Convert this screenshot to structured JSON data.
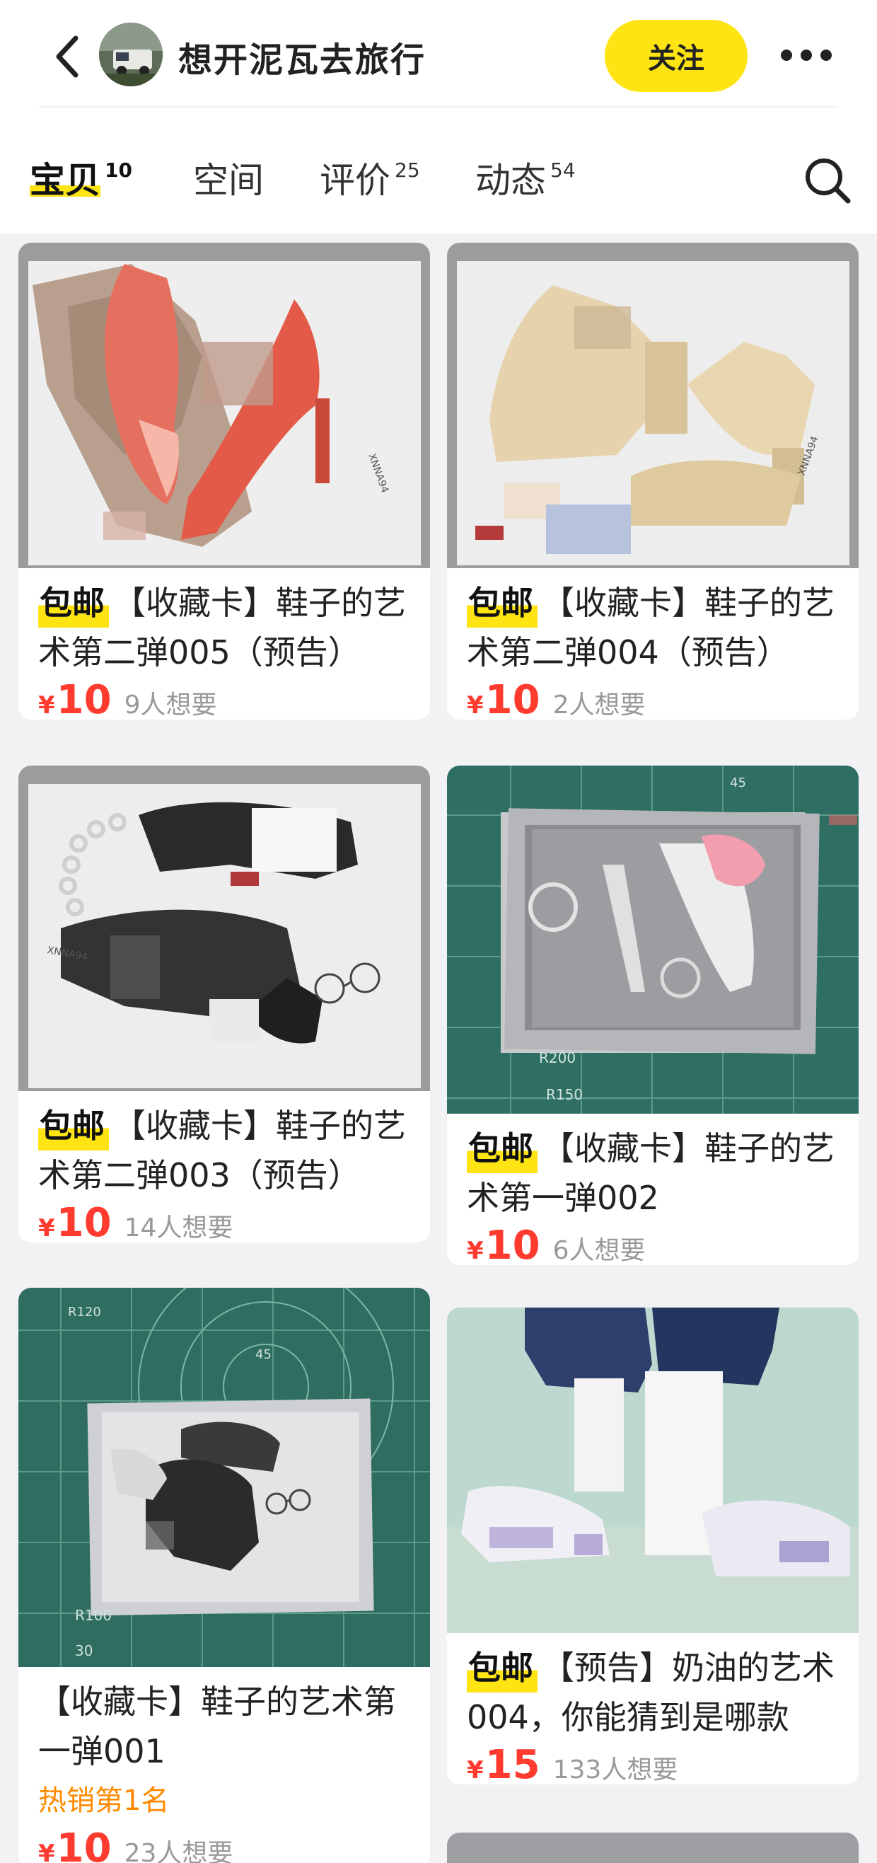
{
  "header": {
    "shop_name": "想开泥瓦去旅行",
    "follow_label": "关注"
  },
  "tabs": [
    {
      "label": "宝贝",
      "count": "10"
    },
    {
      "label": "空间",
      "count": ""
    },
    {
      "label": "评价",
      "count": "25"
    },
    {
      "label": "动态",
      "count": "54"
    }
  ],
  "products": [
    {
      "tag": "包邮",
      "title": "【收藏卡】鞋子的艺术第二弹005（预告）",
      "currency": "¥",
      "price": "10",
      "wants": "9人想要",
      "hot": ""
    },
    {
      "tag": "包邮",
      "title": "【收藏卡】鞋子的艺术第二弹004（预告）",
      "currency": "¥",
      "price": "10",
      "wants": "2人想要",
      "hot": ""
    },
    {
      "tag": "包邮",
      "title": "【收藏卡】鞋子的艺术第二弹003（预告）",
      "currency": "¥",
      "price": "10",
      "wants": "14人想要",
      "hot": ""
    },
    {
      "tag": "包邮",
      "title": "【收藏卡】鞋子的艺术第一弹002",
      "currency": "¥",
      "price": "10",
      "wants": "6人想要",
      "hot": ""
    },
    {
      "tag": "",
      "title": "【收藏卡】鞋子的艺术第一弹001",
      "currency": "¥",
      "price": "10",
      "wants": "23人想要",
      "hot": "热销第1名"
    },
    {
      "tag": "包邮",
      "title": "【预告】奶油的艺术004，你能猜到是哪款",
      "currency": "¥",
      "price": "15",
      "wants": "133人想要",
      "hot": ""
    }
  ],
  "thumb_marks": {
    "p1": "XNNA94",
    "p2": "XNNA94",
    "p3": "XNNA94",
    "p4": [
      "R200",
      "R150",
      "45"
    ],
    "p5": [
      "45",
      "R120",
      "R100",
      "30"
    ]
  },
  "colors": {
    "accent_yellow": "#ffe414",
    "price_red": "#ff3b30",
    "hot_orange": "#ff8a00",
    "mat_green": "#2f6e62"
  },
  "icons": [
    "back-arrow-icon",
    "more-dots-icon",
    "search-icon"
  ]
}
